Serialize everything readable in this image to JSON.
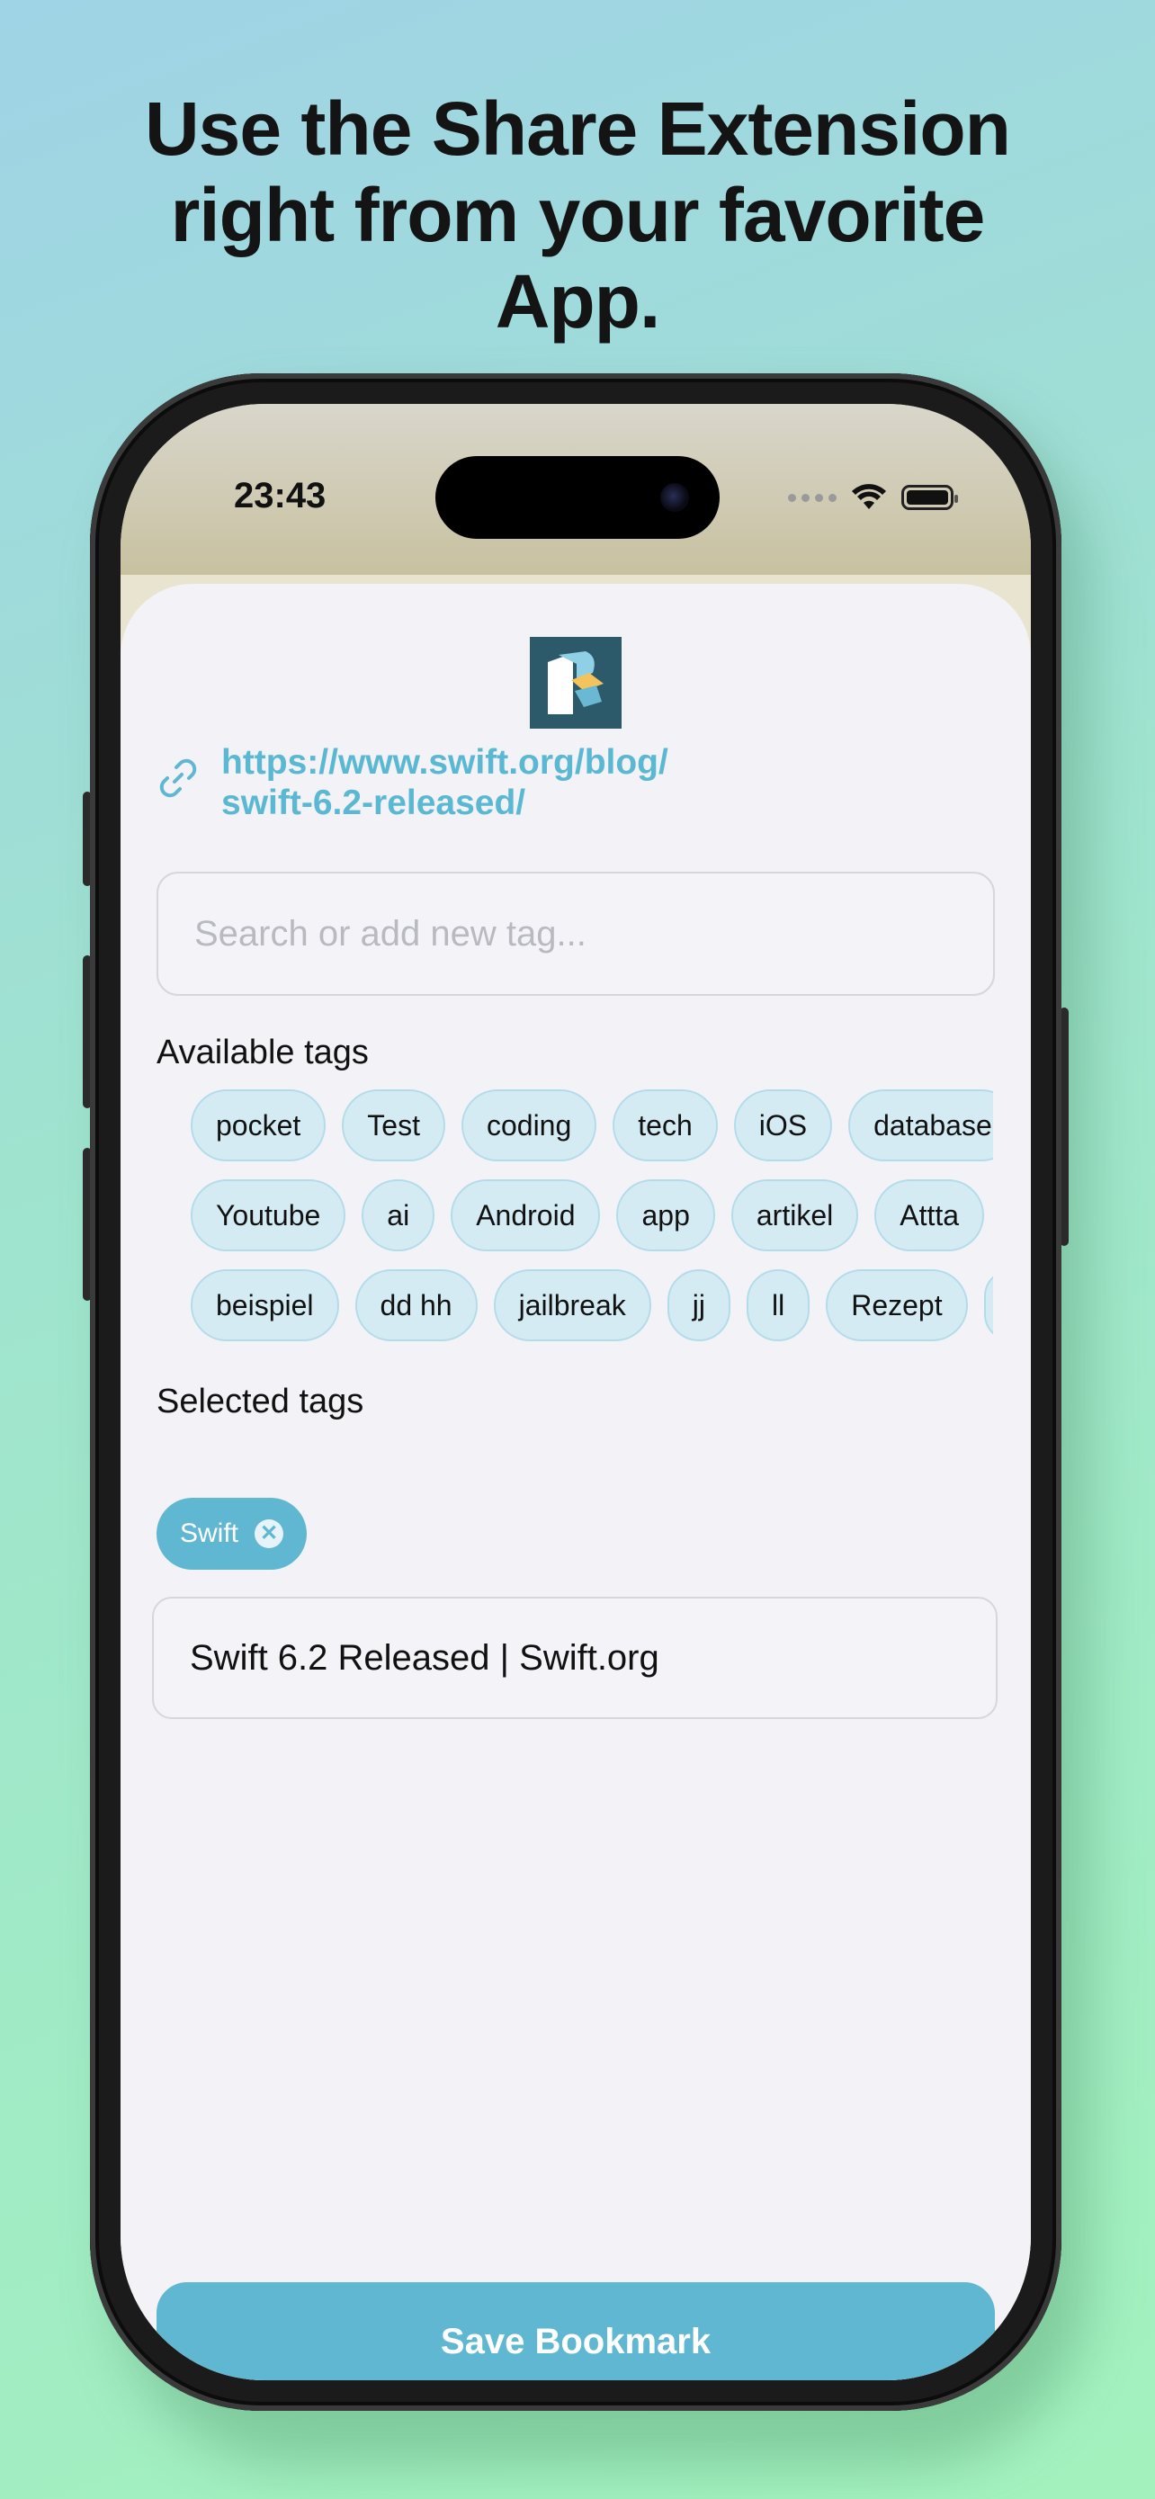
{
  "headline": {
    "line1": "Use the Share Extension",
    "line2": "right from your favorite",
    "line3": "App."
  },
  "status_bar": {
    "time": "23:43"
  },
  "share_sheet": {
    "url_line1": "https://www.swift.org/blog/",
    "url_line2": "swift-6.2-released/",
    "search": {
      "placeholder": "Search or add new tag...",
      "value": ""
    },
    "available_label": "Available tags",
    "available_tags": [
      [
        "pocket",
        "Test",
        "coding",
        "tech",
        "iOS",
        "database"
      ],
      [
        "Youtube",
        "ai",
        "Android",
        "app",
        "artikel",
        "Attta"
      ],
      [
        "beispiel",
        "dd hh",
        "jailbreak",
        "jj",
        "ll",
        "Rezept"
      ]
    ],
    "selected_label": "Selected tags",
    "selected_tags": [
      "Swift"
    ],
    "title_value": "Swift 6.2 Released | Swift.org",
    "save_label": "Save Bookmark"
  },
  "colors": {
    "accent": "#5fb7d1",
    "tag_bg": "#d4ebf3",
    "sheet_bg": "#f2f2f7"
  },
  "icons": [
    "link-icon",
    "app-logo",
    "wifi-icon",
    "battery-icon",
    "close-circle-icon"
  ]
}
